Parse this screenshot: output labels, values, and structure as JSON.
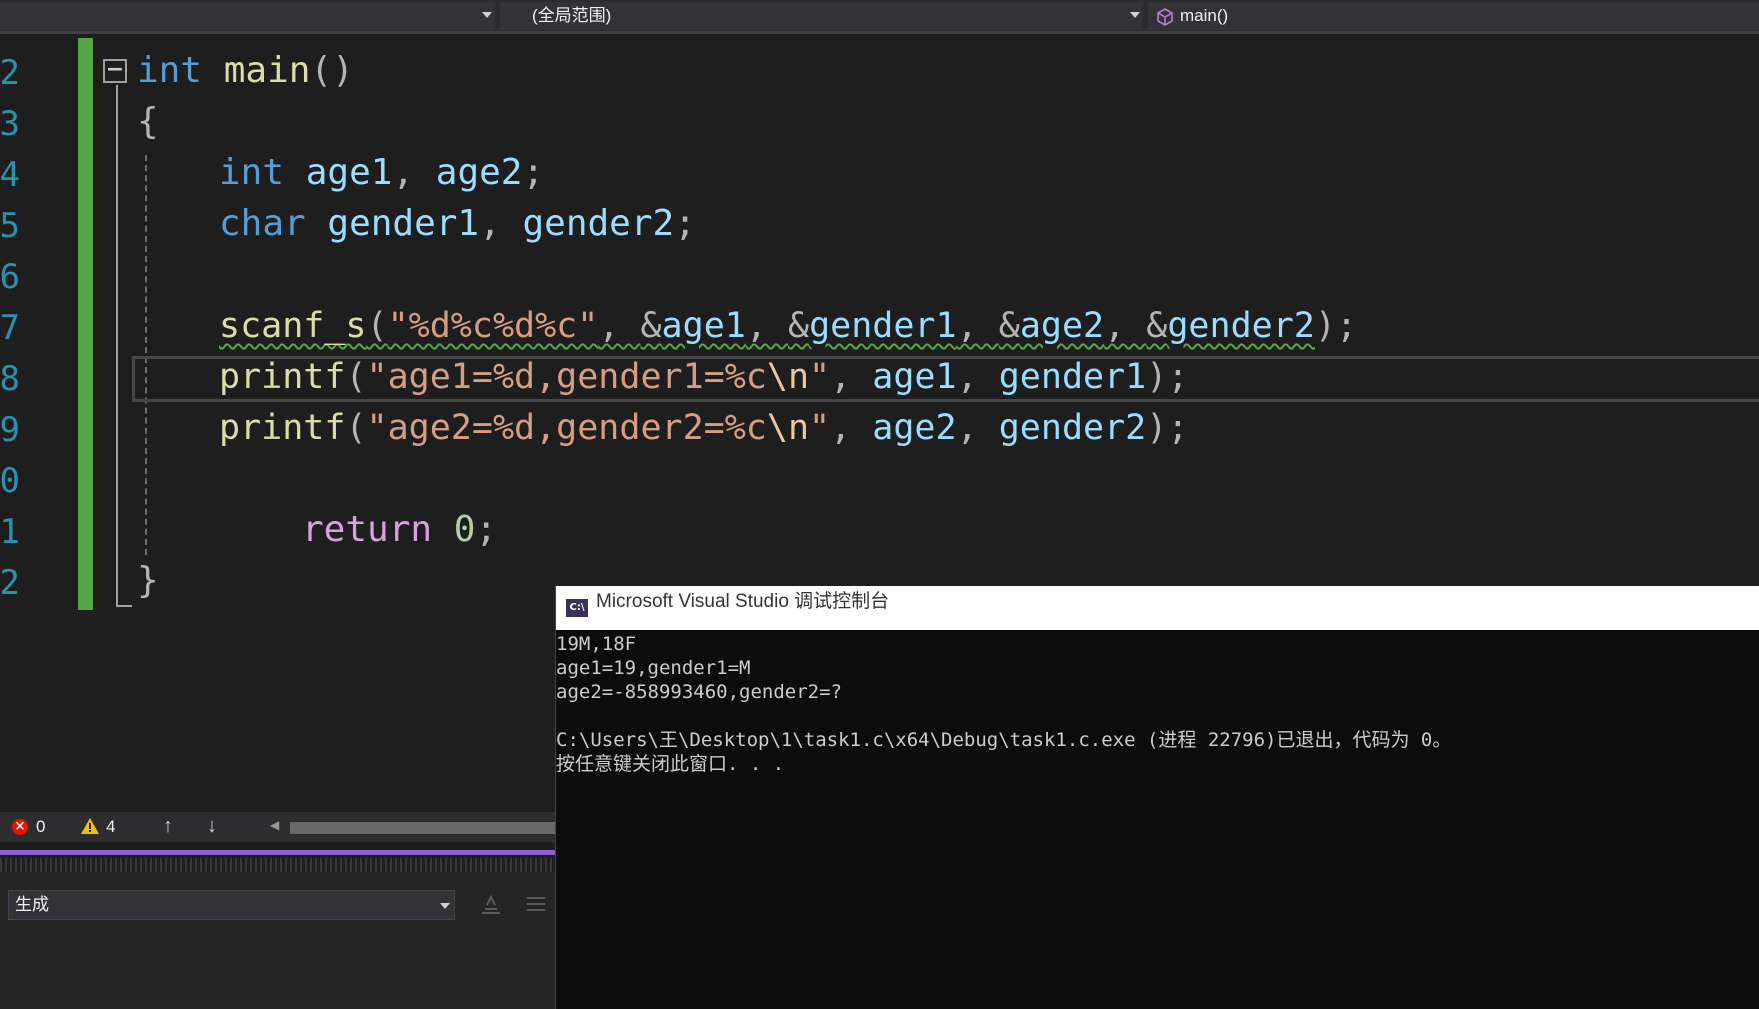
{
  "navbar": {
    "project_combo": "",
    "scope_combo": "(全局范围)",
    "member_combo": "main()"
  },
  "editor": {
    "line_numbers": [
      "2",
      "3",
      "4",
      "5",
      "6",
      "7",
      "8",
      "9",
      "0",
      "1",
      "2"
    ],
    "code": {
      "l1_kw": "int",
      "l1_fn": "main",
      "l1_p": "()",
      "l2": "{",
      "l3_kw": "int",
      "l3_v1": "age1",
      "l3_p1": ", ",
      "l3_v2": "age2",
      "l3_p2": ";",
      "l4_kw": "char",
      "l4_v1": "gender1",
      "l4_p1": ", ",
      "l4_v2": "gender2",
      "l4_p2": ";",
      "l6_fn": "scanf_s",
      "l6_p1": "(",
      "l6_str": "\"%d%c%d%c\"",
      "l6_p2": ", ",
      "l6_a1": "&",
      "l6_v1": "age1",
      "l6_p3": ", ",
      "l6_a2": "&",
      "l6_v2": "gender1",
      "l6_p4": ", ",
      "l6_a3": "&",
      "l6_v3": "age2",
      "l6_p5": ", ",
      "l6_a4": "&",
      "l6_v4": "gender2",
      "l6_p6": ")",
      "l6_p7": ";",
      "l7_fn": "printf",
      "l7_p1": "(",
      "l7_str": "\"age1=%d,gender1=%c",
      "l7_esc": "\\n",
      "l7_q": "\"",
      "l7_p2": ", ",
      "l7_v1": "age1",
      "l7_p3": ", ",
      "l7_v2": "gender1",
      "l7_p4": ");",
      "l8_fn": "printf",
      "l8_p1": "(",
      "l8_str": "\"age2=%d,gender2=%c",
      "l8_esc": "\\n",
      "l8_q": "\"",
      "l8_p2": ", ",
      "l8_v1": "age2",
      "l8_p3": ", ",
      "l8_v2": "gender2",
      "l8_p4": ");",
      "l10_kw": "return",
      "l10_num": "0",
      "l10_p": ";",
      "l11": "}"
    },
    "fold_symbol": "−"
  },
  "status": {
    "errors": "0",
    "warnings": "4",
    "up_arrow": "↑",
    "down_arrow": "↓",
    "scroll_left": "◀"
  },
  "output": {
    "source_combo": "生成"
  },
  "console": {
    "icon_text": "C:\\",
    "title": "Microsoft Visual Studio 调试控制台",
    "lines": [
      "19M,18F",
      "age1=19,gender1=M",
      "age2=-858993460,gender2=?",
      "",
      "C:\\Users\\王\\Desktop\\1\\task1.c\\x64\\Debug\\task1.c.exe (进程 22796)已退出，代码为 0。",
      "按任意键关闭此窗口. . ."
    ]
  },
  "colors": {
    "keyword": "#569cd6",
    "variable": "#9cdcfe",
    "function": "#dcdcaa",
    "string": "#d69d85",
    "line_number": "#2b91af",
    "change_bar": "#57a64a"
  }
}
